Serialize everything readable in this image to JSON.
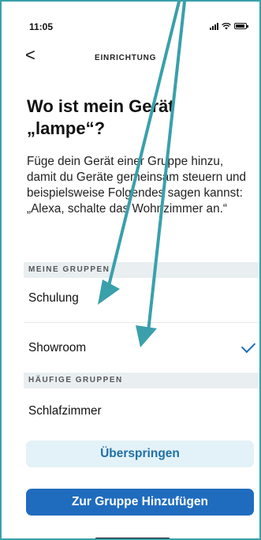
{
  "status_bar": {
    "time": "11:05"
  },
  "nav": {
    "back_label": "<",
    "title": "EINRICHTUNG"
  },
  "heading": "Wo ist mein Gerät „lampe“?",
  "description": "Füge dein Gerät einer Gruppe hinzu, damit du Geräte gemeinsam steuern und beispielsweise Folgendes sagen kannst: „Alexa, schalte das Wohnzimmer an.“",
  "sections": {
    "my_groups": {
      "label": "MEINE GRUPPEN",
      "items": [
        {
          "label": "Schulung",
          "selected": false
        },
        {
          "label": "Showroom",
          "selected": true
        }
      ]
    },
    "common_groups": {
      "label": "HÄUFIGE GRUPPEN",
      "items": [
        {
          "label": "Schlafzimmer",
          "selected": false
        }
      ]
    }
  },
  "buttons": {
    "skip": "Überspringen",
    "add": "Zur Gruppe Hinzufügen"
  },
  "colors": {
    "accent": "#1f6cbe",
    "annotation_arrow": "#3aa0ab",
    "section_bg": "#e9eef0"
  }
}
